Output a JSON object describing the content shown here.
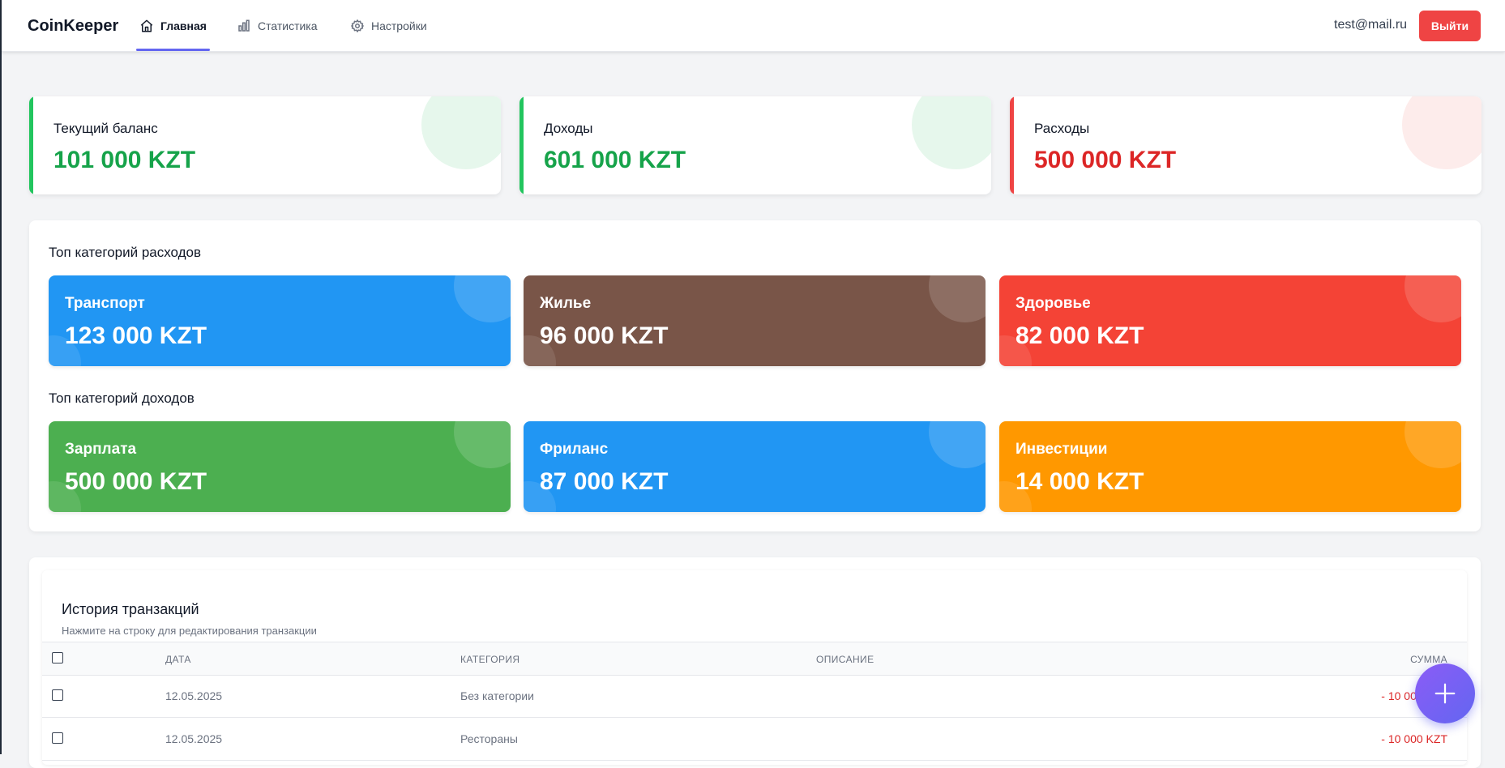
{
  "app": {
    "brand": "CoinKeeper"
  },
  "nav": {
    "items": [
      {
        "label": "Главная",
        "icon": "home-icon",
        "active": true
      },
      {
        "label": "Статистика",
        "icon": "bar-chart-icon",
        "active": false
      },
      {
        "label": "Настройки",
        "icon": "gear-icon",
        "active": false
      }
    ]
  },
  "user": {
    "email": "test@mail.ru",
    "logout_label": "Выйти"
  },
  "summary": {
    "balance": {
      "label": "Текущий баланс",
      "value": "101 000 KZT",
      "color": "#16a34a"
    },
    "income": {
      "label": "Доходы",
      "value": "601 000 KZT",
      "color": "#16a34a"
    },
    "expenses": {
      "label": "Расходы",
      "value": "500 000 KZT",
      "color": "#dc2626"
    }
  },
  "top_expenses": {
    "title": "Топ категорий расходов",
    "items": [
      {
        "name": "Транспорт",
        "amount": "123 000 KZT",
        "color": "#2196f3"
      },
      {
        "name": "Жилье",
        "amount": "96 000 KZT",
        "color": "#795548"
      },
      {
        "name": "Здоровье",
        "amount": "82 000 KZT",
        "color": "#f44336"
      }
    ]
  },
  "top_income": {
    "title": "Топ категорий доходов",
    "items": [
      {
        "name": "Зарплата",
        "amount": "500 000 KZT",
        "color": "#4caf50"
      },
      {
        "name": "Фриланс",
        "amount": "87 000 KZT",
        "color": "#2196f3"
      },
      {
        "name": "Инвестиции",
        "amount": "14 000 KZT",
        "color": "#ff9800"
      }
    ]
  },
  "transactions": {
    "title": "История транзакций",
    "subtitle": "Нажмите на строку для редактирования транзакции",
    "columns": {
      "date": "ДАТА",
      "category": "КАТЕГОРИЯ",
      "description": "ОПИСАНИЕ",
      "sum": "СУММА"
    },
    "rows": [
      {
        "date": "12.05.2025",
        "category": "Без категории",
        "description": "",
        "sum": "- 10 000 KZT"
      },
      {
        "date": "12.05.2025",
        "category": "Рестораны",
        "description": "",
        "sum": "- 10 000 KZT"
      }
    ]
  },
  "fab": {
    "icon": "plus-icon"
  }
}
